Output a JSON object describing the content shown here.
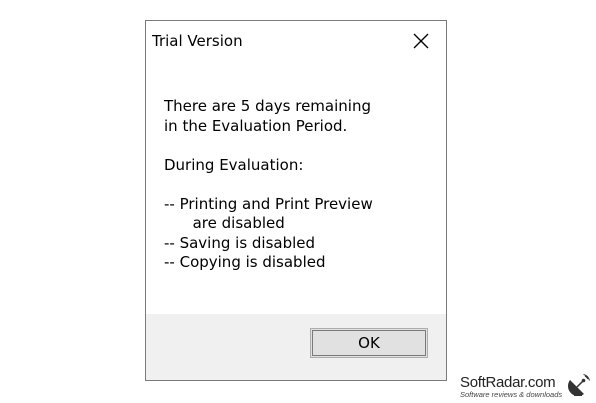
{
  "dialog": {
    "title": "Trial Version",
    "message": {
      "line1": "There are 5 days remaining",
      "line2": "in the Evaluation Period.",
      "heading": "During Evaluation:",
      "items": [
        "-- Printing and Print Preview",
        "      are disabled",
        "-- Saving is disabled",
        "-- Copying is disabled"
      ]
    },
    "ok_label": "OK",
    "close_icon": "close-icon"
  },
  "watermark": {
    "name": "SoftRadar.com",
    "tagline": "Software reviews & downloads",
    "icon": "satellite-dish-icon"
  },
  "colors": {
    "footer_bg": "#f0f0f0",
    "button_bg": "#e1e1e1",
    "border": "#7a7a7a"
  }
}
